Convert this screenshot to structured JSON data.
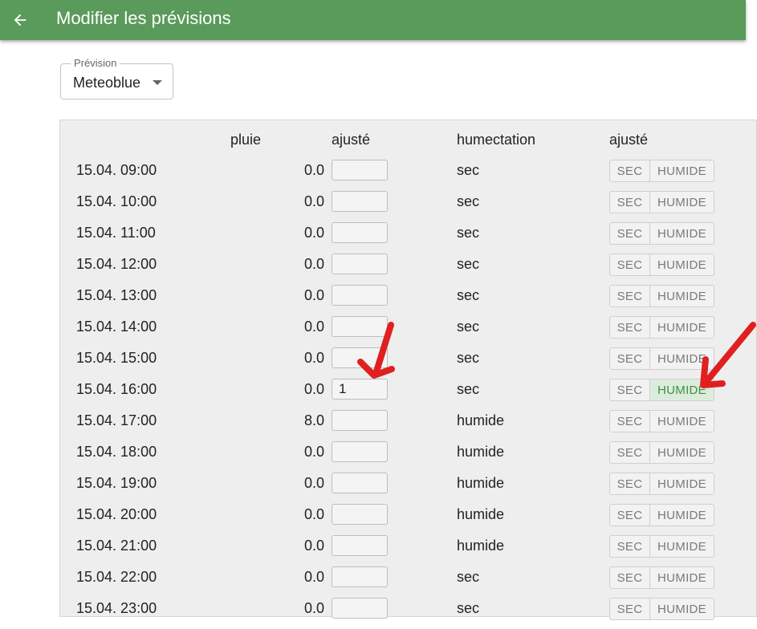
{
  "appbar": {
    "title": "Modifier les prévisions",
    "back_icon": "arrow-left-icon"
  },
  "forecast_select": {
    "label": "Prévision",
    "value": "Meteoblue"
  },
  "table": {
    "headers": {
      "rain": "pluie",
      "rain_adjusted": "ajusté",
      "wetness": "humectation",
      "wetness_adjusted": "ajusté"
    },
    "toggle_labels": {
      "dry": "SEC",
      "wet": "HUMIDE"
    },
    "rows": [
      {
        "time": "15.04. 09:00",
        "rain": "0.0",
        "adjusted": "",
        "wetness": "sec",
        "selected": ""
      },
      {
        "time": "15.04. 10:00",
        "rain": "0.0",
        "adjusted": "",
        "wetness": "sec",
        "selected": ""
      },
      {
        "time": "15.04. 11:00",
        "rain": "0.0",
        "adjusted": "",
        "wetness": "sec",
        "selected": ""
      },
      {
        "time": "15.04. 12:00",
        "rain": "0.0",
        "adjusted": "",
        "wetness": "sec",
        "selected": ""
      },
      {
        "time": "15.04. 13:00",
        "rain": "0.0",
        "adjusted": "",
        "wetness": "sec",
        "selected": ""
      },
      {
        "time": "15.04. 14:00",
        "rain": "0.0",
        "adjusted": "",
        "wetness": "sec",
        "selected": ""
      },
      {
        "time": "15.04. 15:00",
        "rain": "0.0",
        "adjusted": "",
        "wetness": "sec",
        "selected": ""
      },
      {
        "time": "15.04. 16:00",
        "rain": "0.0",
        "adjusted": "1",
        "wetness": "sec",
        "selected": "wet"
      },
      {
        "time": "15.04. 17:00",
        "rain": "8.0",
        "adjusted": "",
        "wetness": "humide",
        "selected": ""
      },
      {
        "time": "15.04. 18:00",
        "rain": "0.0",
        "adjusted": "",
        "wetness": "humide",
        "selected": ""
      },
      {
        "time": "15.04. 19:00",
        "rain": "0.0",
        "adjusted": "",
        "wetness": "humide",
        "selected": ""
      },
      {
        "time": "15.04. 20:00",
        "rain": "0.0",
        "adjusted": "",
        "wetness": "humide",
        "selected": ""
      },
      {
        "time": "15.04. 21:00",
        "rain": "0.0",
        "adjusted": "",
        "wetness": "humide",
        "selected": ""
      },
      {
        "time": "15.04. 22:00",
        "rain": "0.0",
        "adjusted": "",
        "wetness": "sec",
        "selected": ""
      },
      {
        "time": "15.04. 23:00",
        "rain": "0.0",
        "adjusted": "",
        "wetness": "sec",
        "selected": ""
      }
    ]
  },
  "colors": {
    "appbar": "#5a9a5b",
    "panel": "#eeeeee",
    "active_toggle": "#3f8f3f",
    "annotation": "#e02020"
  }
}
